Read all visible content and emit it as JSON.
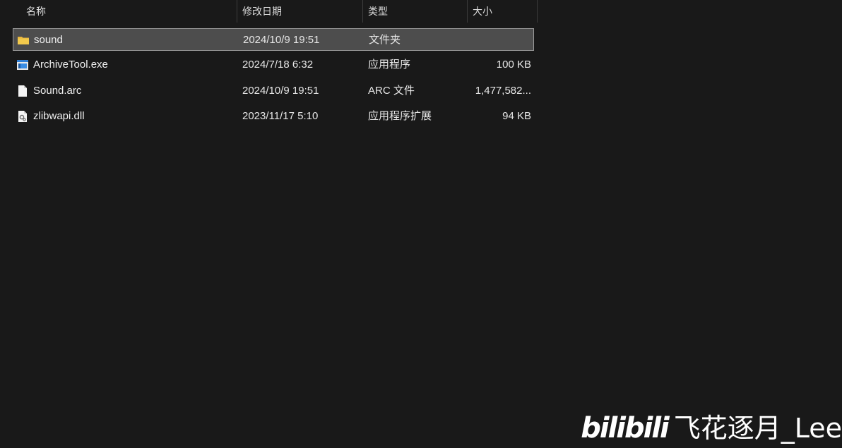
{
  "columns": {
    "name": "名称",
    "date": "修改日期",
    "type": "类型",
    "size": "大小"
  },
  "sort_indicator": "^",
  "files": [
    {
      "name": "sound",
      "date": "2024/10/9 19:51",
      "type": "文件夹",
      "size": "",
      "icon": "folder-icon",
      "selected": true
    },
    {
      "name": "ArchiveTool.exe",
      "date": "2024/7/18 6:32",
      "type": "应用程序",
      "size": "100 KB",
      "icon": "exe-icon",
      "selected": false
    },
    {
      "name": "Sound.arc",
      "date": "2024/10/9 19:51",
      "type": "ARC 文件",
      "size": "1,477,582...",
      "icon": "file-icon",
      "selected": false
    },
    {
      "name": "zlibwapi.dll",
      "date": "2023/11/17 5:10",
      "type": "应用程序扩展",
      "size": "94 KB",
      "icon": "dll-icon",
      "selected": false
    }
  ],
  "watermark": {
    "logo": "bilibili",
    "user": "飞花逐月_Lee"
  },
  "colors": {
    "background": "#191919",
    "selected_row": "#4d4d4d",
    "selected_border": "#9a9a9a",
    "folder": "#f2c94c",
    "exe_accent": "#2f7fd6"
  }
}
